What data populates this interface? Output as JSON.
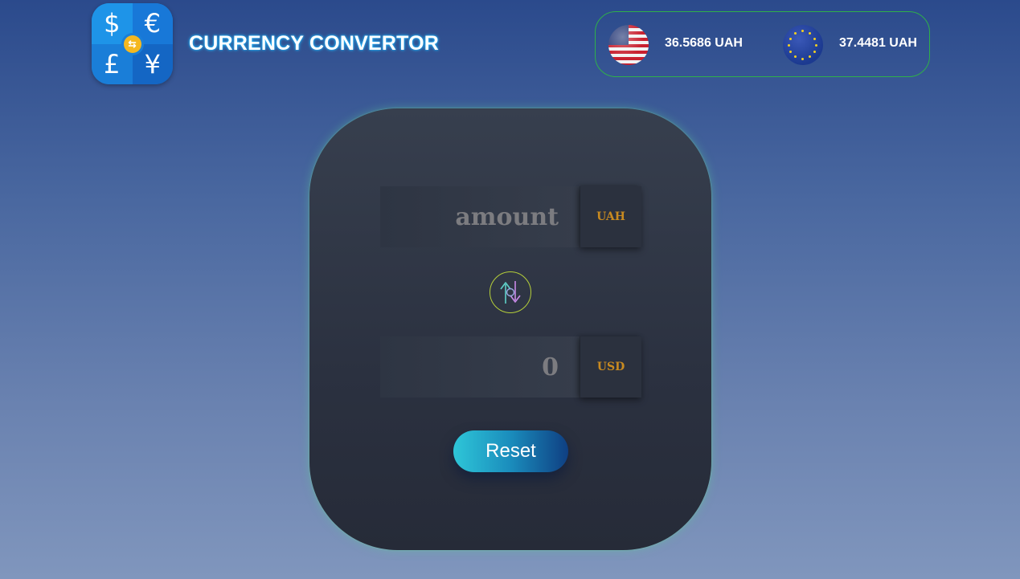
{
  "header": {
    "title": "CURRENCY CONVERTOR",
    "logo": {
      "symbols": [
        "$",
        "€",
        "£",
        "¥"
      ],
      "center_icon": "swap-coin-icon"
    }
  },
  "rates": [
    {
      "flag": "us-flag-icon",
      "value": "36.5686 UAH"
    },
    {
      "flag": "eu-flag-icon",
      "value": "37.4481 UAH"
    }
  ],
  "converter": {
    "from": {
      "placeholder": "amount",
      "currency": "UAH"
    },
    "swap_icon": "swap-arrows-icon",
    "to": {
      "value": "0",
      "currency": "USD"
    },
    "reset_label": "Reset"
  },
  "colors": {
    "accent_orange": "#c88a20",
    "rates_border": "#2fb04a",
    "swap_ring": "#b5cf3a",
    "reset_start": "#2ec6d8",
    "reset_end": "#0f3f82"
  }
}
